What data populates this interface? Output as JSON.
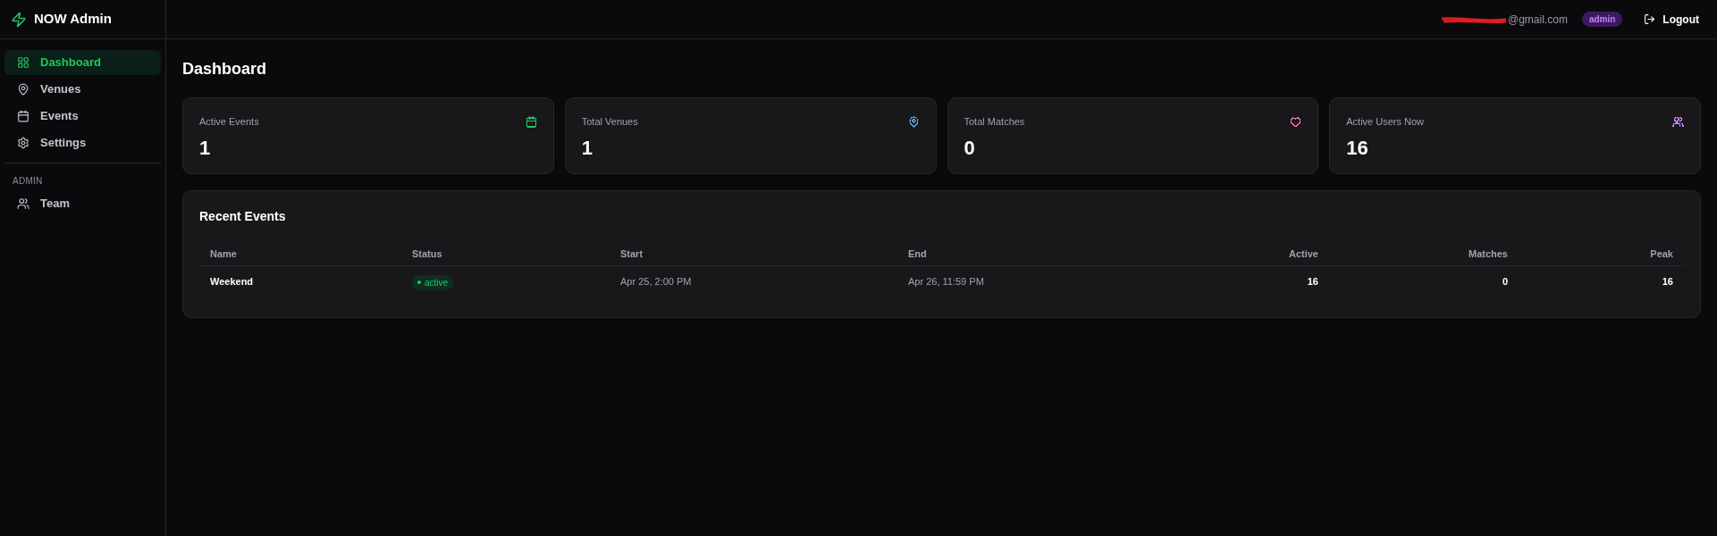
{
  "brand": {
    "title": "NOW Admin"
  },
  "header": {
    "email": "@gmail.com",
    "role": "admin",
    "logout": "Logout"
  },
  "sidebar": {
    "items": [
      {
        "label": "Dashboard",
        "selected": true
      },
      {
        "label": "Venues",
        "selected": false
      },
      {
        "label": "Events",
        "selected": false
      },
      {
        "label": "Settings",
        "selected": false
      }
    ],
    "section": "ADMIN",
    "admin_items": [
      {
        "label": "Team",
        "selected": false
      }
    ]
  },
  "page": {
    "title": "Dashboard"
  },
  "stats": [
    {
      "label": "Active Events",
      "value": "1",
      "color": "#22c55e"
    },
    {
      "label": "Total Venues",
      "value": "1",
      "color": "#60a5fa"
    },
    {
      "label": "Total Matches",
      "value": "0",
      "color": "#f472b6"
    },
    {
      "label": "Active Users Now",
      "value": "16",
      "color": "#c084fc"
    }
  ],
  "recent_events": {
    "title": "Recent Events",
    "columns": [
      "Name",
      "Status",
      "Start",
      "End",
      "Active",
      "Matches",
      "Peak"
    ],
    "rows": [
      {
        "name": "Weekend",
        "status": "active",
        "start": "Apr 25, 2:00 PM",
        "end": "Apr 26, 11:59 PM",
        "active": "16",
        "matches": "0",
        "peak": "16"
      }
    ]
  }
}
